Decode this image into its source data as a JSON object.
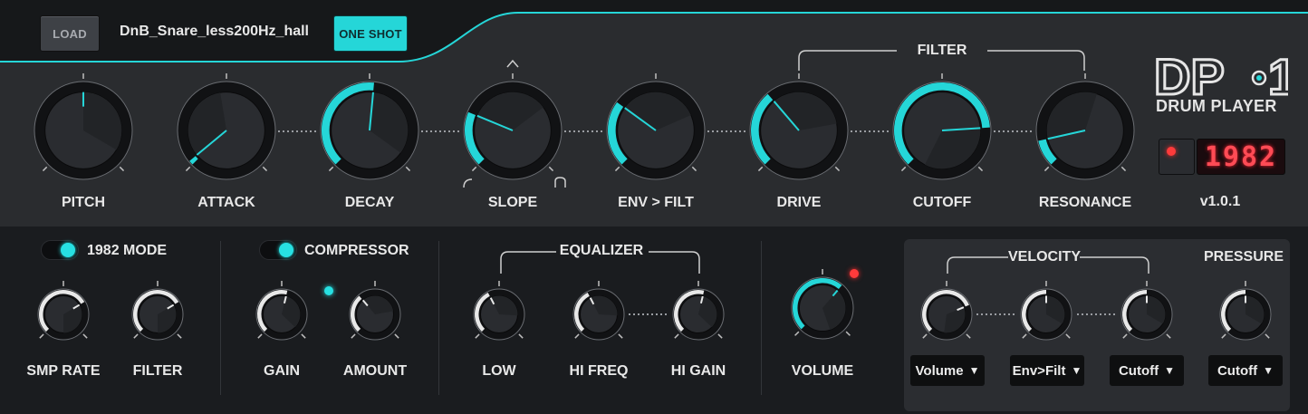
{
  "header": {
    "load_label": "LOAD",
    "sample_name": "DnB_Snare_less200Hz_hall",
    "oneshot_label": "ONE SHOT"
  },
  "main_knobs": [
    {
      "label": "PITCH",
      "value": 0.5,
      "bipolar": true
    },
    {
      "label": "ATTACK",
      "value": 0.02
    },
    {
      "label": "DECAY",
      "value": 0.52
    },
    {
      "label": "SLOPE",
      "value": 0.25
    },
    {
      "label": "ENV > FILT",
      "value": 0.3
    },
    {
      "label": "DRIVE",
      "value": 0.35
    },
    {
      "label": "CUTOFF",
      "value": 0.82
    },
    {
      "label": "RESONANCE",
      "value": 0.12
    }
  ],
  "filter_group_label": "FILTER",
  "logo": {
    "title": "DP",
    "digit": "1",
    "subtitle": "DRUM PLAYER"
  },
  "display": {
    "value": "1982",
    "version": "v1.0.1"
  },
  "mode_1982": {
    "label": "1982 MODE",
    "on": true,
    "knobs": [
      {
        "label": "SMP RATE",
        "value": 0.72
      },
      {
        "label": "FILTER",
        "value": 0.72
      }
    ]
  },
  "compressor": {
    "label": "COMPRESSOR",
    "on": true,
    "knobs": [
      {
        "label": "GAIN",
        "value": 0.55
      },
      {
        "label": "AMOUNT",
        "value": 0.35
      }
    ]
  },
  "equalizer": {
    "label": "EQUALIZER",
    "knobs": [
      {
        "label": "LOW",
        "value": 0.4
      },
      {
        "label": "HI FREQ",
        "value": 0.4
      },
      {
        "label": "HI GAIN",
        "value": 0.55
      }
    ]
  },
  "volume": {
    "label": "VOLUME",
    "value": 0.65
  },
  "velocity": {
    "label": "VELOCITY",
    "knobs": [
      {
        "value": 0.75,
        "target": "Volume"
      },
      {
        "value": 0.5,
        "target": "Env>Filt"
      },
      {
        "value": 0.5,
        "target": "Cutoff"
      }
    ]
  },
  "pressure": {
    "label": "PRESSURE",
    "knob": {
      "value": 0.5,
      "target": "Cutoff"
    }
  },
  "colors": {
    "accent": "#25d6d8",
    "white_arc": "#e8e8e8",
    "led_red": "#ff3b3b",
    "panel_bg": "#1c1e21"
  }
}
